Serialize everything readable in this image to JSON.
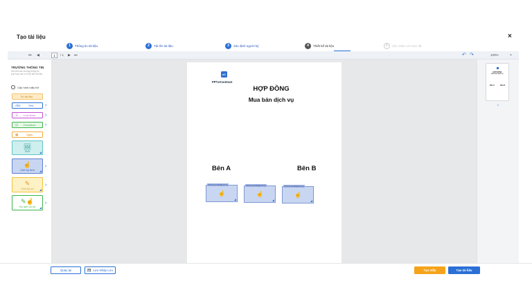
{
  "header": {
    "title": "Tạo tài liệu",
    "close": "×"
  },
  "steps": [
    {
      "num": "1",
      "label": "Thông tin tài liệu"
    },
    {
      "num": "2",
      "label": "Tải lên tài liệu"
    },
    {
      "num": "3",
      "label": "Xác định người ký"
    },
    {
      "num": "4",
      "label": "Thiết kế tài liệu"
    },
    {
      "num": "5",
      "label": "Xác nhận và hoàn tất"
    }
  ],
  "toolbar": {
    "first": "⏮",
    "prev": "◀",
    "page": "1",
    "total": "/ 1",
    "next": "▶",
    "last": "⏭",
    "undo": "↶",
    "redo": "↷",
    "zoom": "100%",
    "zoom_chevron": "⌄"
  },
  "left_panel": {
    "title": "TRƯỜNG THÔNG TIN",
    "desc": "Kéo thả các trường thông tin phù hợp vào vị trí ký trên tài liệu",
    "config_label": "Cấu hình mẫu trữ",
    "fields": {
      "f1": {
        "label": "Số tài liệu"
      },
      "f2": {
        "label": "Text",
        "icon": "Abc"
      },
      "f3": {
        "label": "Lựa chọn"
      },
      "f4": {
        "label": "Checkbox"
      },
      "f5": {
        "label": "Ngày"
      }
    },
    "big": {
      "anh": {
        "label": "Ảnh"
      },
      "chuky_anh": {
        "label": "Chữ ký ảnh"
      },
      "chuky_so": {
        "label": "Chữ ký số"
      },
      "kyanh_so": {
        "label": "Ký ảnh và số"
      }
    }
  },
  "doc": {
    "logo_icon": "eC",
    "logo_text": "FPT.eContract",
    "title": "HỢP ĐỒNG",
    "subtitle": "Mua bán dịch vụ",
    "party_a": "Bên A",
    "party_b": "Bên B",
    "sig_tags": [
      "Chữ ký ảnh/Người ký",
      "Chữ ký ảnh/Người ký",
      "Chữ ký ảnh/Người ký"
    ]
  },
  "thumbnail": {
    "title": "HỢP ĐỒNG",
    "subtitle": "Mua bán dịch vụ",
    "party_a": "Bên A",
    "party_b": "Bên B",
    "page_num": "1"
  },
  "footer": {
    "back": "Quay lại",
    "save_draft": "Lưu Nháp Lưu",
    "save_template": "Tạo mẫu",
    "create": "Tạo tài liệu"
  },
  "colors": {
    "primary": "#2a6fd6",
    "orange": "#f5a31a",
    "sig_fill": "#c9d6f1"
  }
}
